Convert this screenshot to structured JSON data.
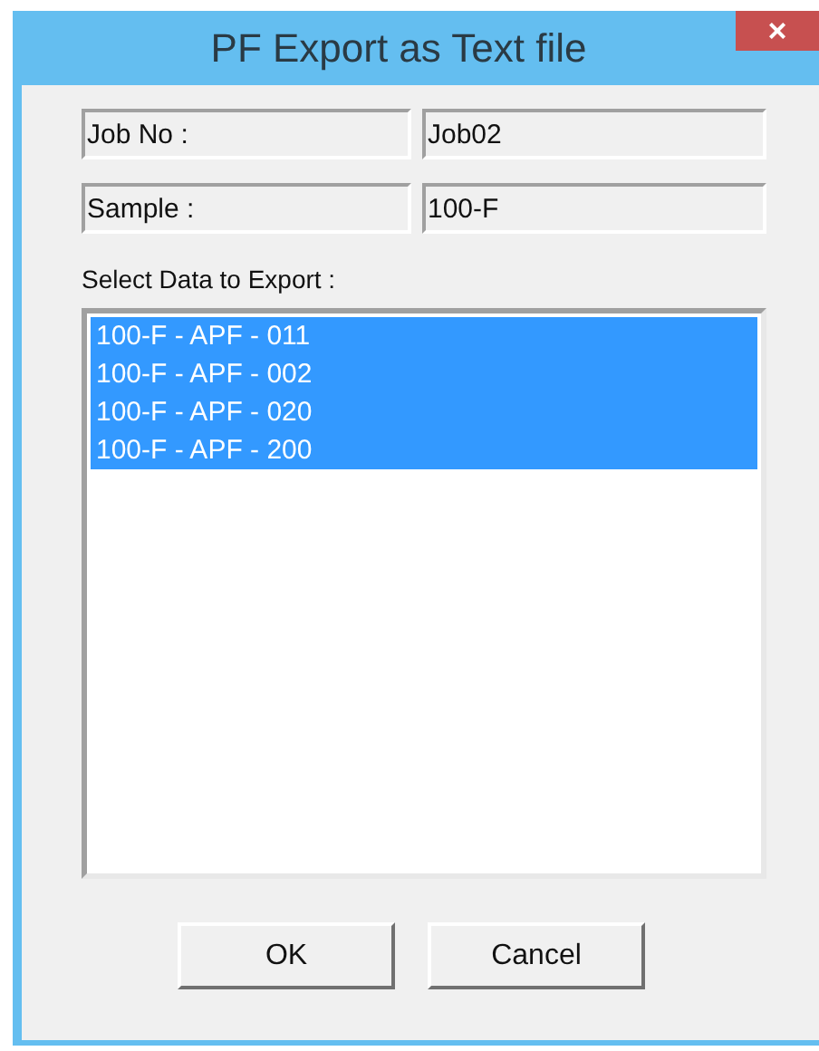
{
  "window": {
    "title": "PF Export as Text file",
    "close": "×"
  },
  "fields": [
    {
      "label": "Job No :",
      "value": "Job02"
    },
    {
      "label": "Sample :",
      "value": "100-F"
    }
  ],
  "list": {
    "label": "Select Data to Export :",
    "items": [
      {
        "text": "100-F - APF - 011",
        "selected": true
      },
      {
        "text": "100-F - APF - 002",
        "selected": true
      },
      {
        "text": "100-F - APF - 020",
        "selected": true
      },
      {
        "text": "100-F - APF - 200",
        "selected": true
      }
    ]
  },
  "buttons": [
    "OK",
    "Cancel"
  ]
}
